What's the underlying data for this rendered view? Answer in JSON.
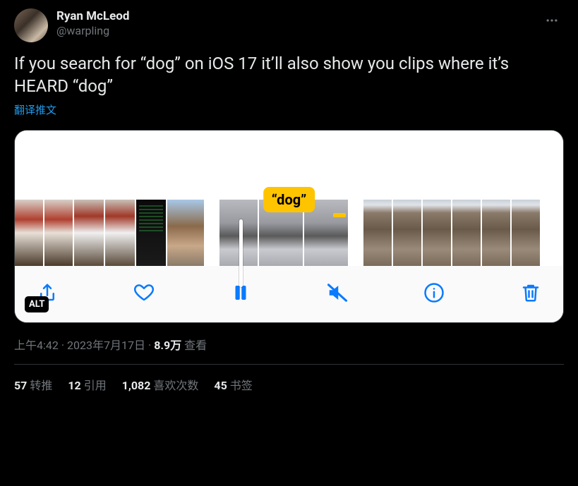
{
  "author": {
    "display_name": "Ryan McLeod",
    "handle": "@warpling"
  },
  "tweet_text": "If you search for “dog” on iOS 17 it’ll also show you clips where it’s HEARD “dog”",
  "translate_label": "翻译推文",
  "media": {
    "caption_text": "“dog”",
    "alt_badge": "ALT",
    "toolbar": {
      "share": "share-icon",
      "like": "heart-icon",
      "pause": "pause-icon",
      "mute": "mute-icon",
      "info": "info-icon",
      "trash": "trash-icon"
    }
  },
  "meta": {
    "time": "上午4:42",
    "date": "2023年7月17日",
    "views_count": "8.9万",
    "views_label": "查看"
  },
  "stats": {
    "retweets": {
      "count": "57",
      "label": "转推"
    },
    "quotes": {
      "count": "12",
      "label": "引用"
    },
    "likes": {
      "count": "1,082",
      "label": "喜欢次数"
    },
    "bookmarks": {
      "count": "45",
      "label": "书签"
    }
  }
}
